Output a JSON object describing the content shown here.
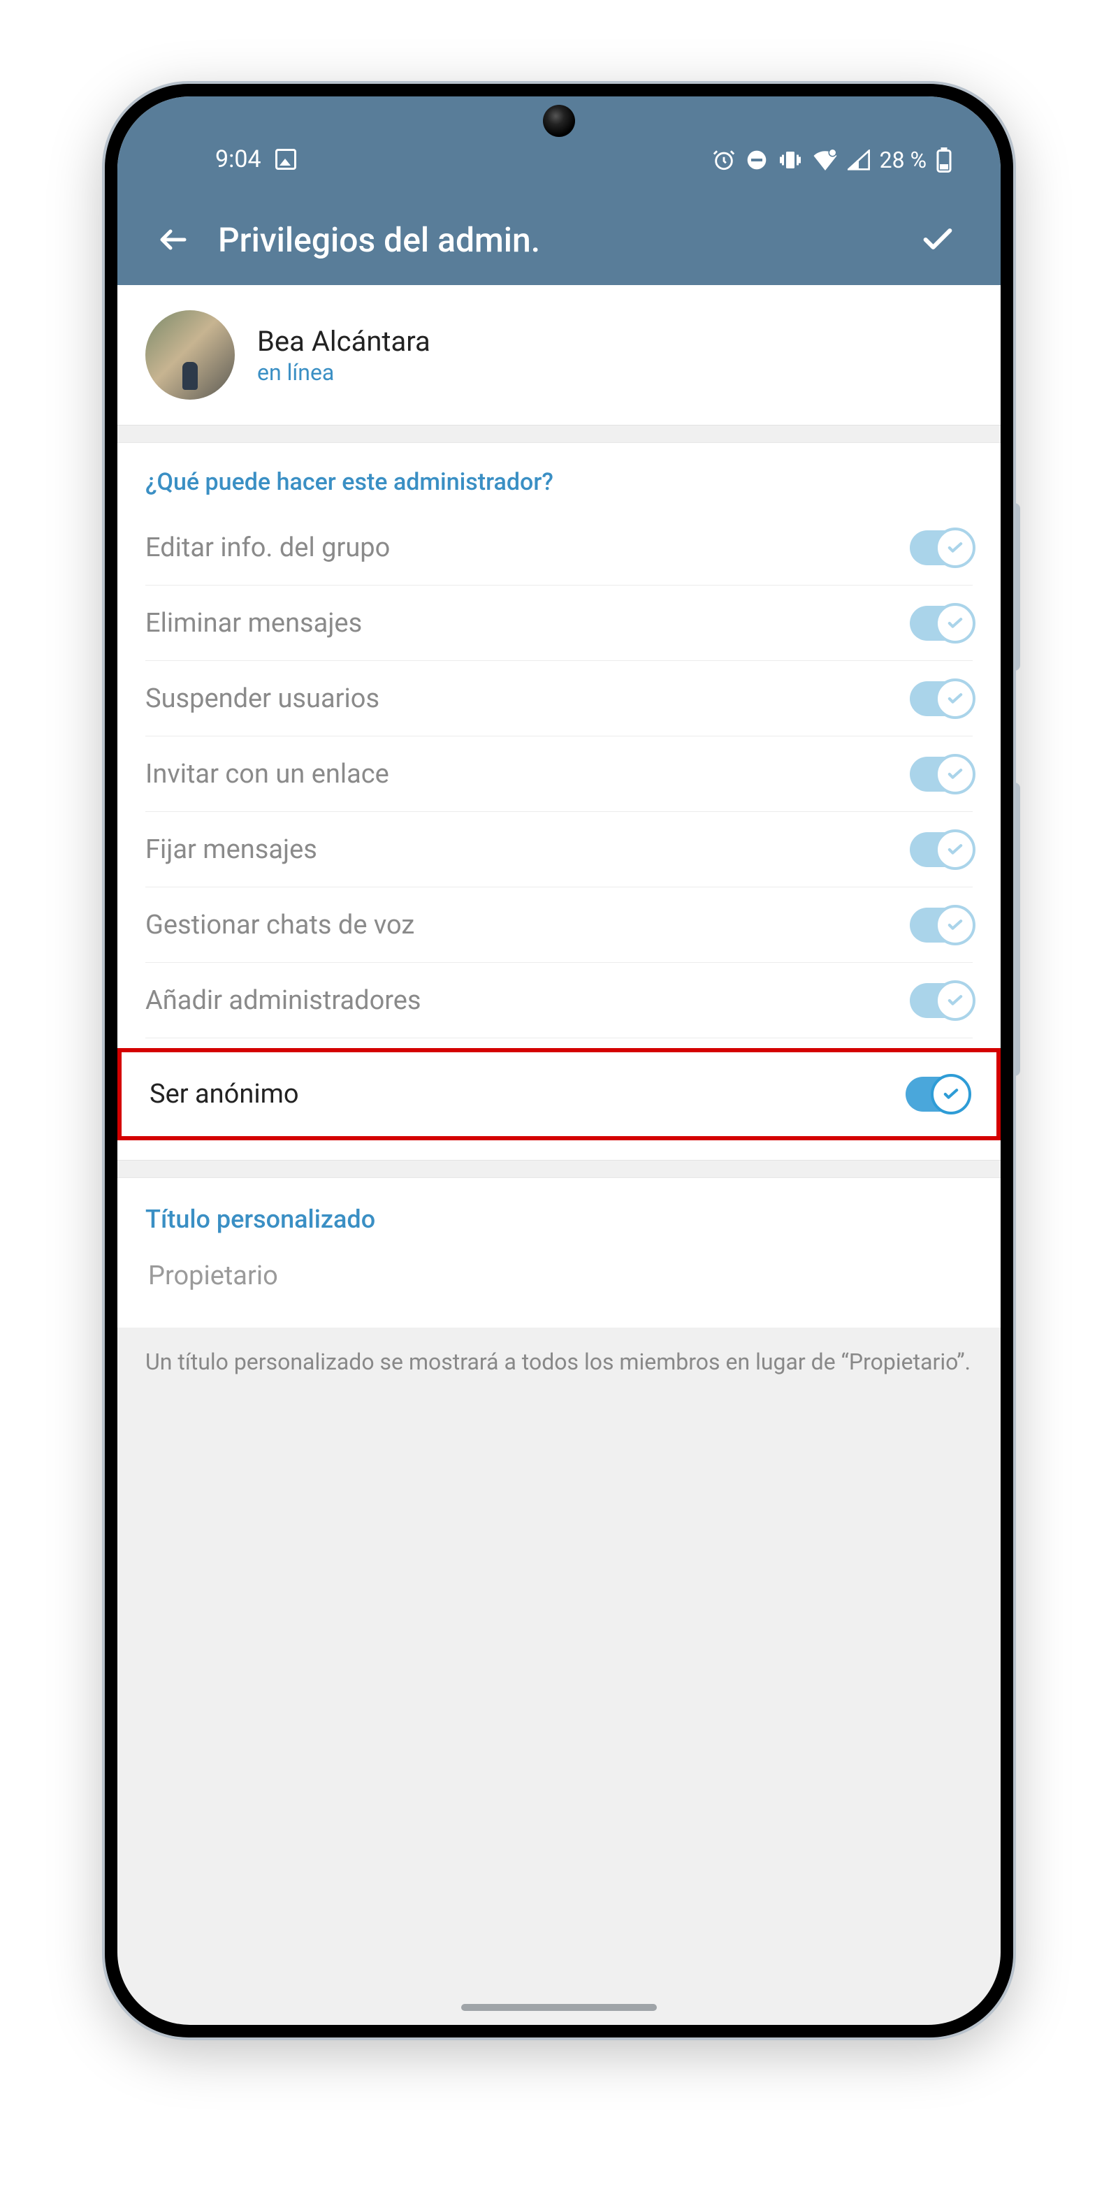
{
  "status": {
    "time": "9:04",
    "battery_text": "28 %"
  },
  "appbar": {
    "title": "Privilegios del admin."
  },
  "profile": {
    "name": "Bea Alcántara",
    "status": "en línea"
  },
  "section": {
    "header": "¿Qué puede hacer este administrador?",
    "permissions": [
      {
        "label": "Editar info. del grupo"
      },
      {
        "label": "Eliminar mensajes"
      },
      {
        "label": "Suspender usuarios"
      },
      {
        "label": "Invitar con un enlace"
      },
      {
        "label": "Fijar mensajes"
      },
      {
        "label": "Gestionar chats de voz"
      },
      {
        "label": "Añadir administradores"
      }
    ],
    "highlighted": {
      "label": "Ser anónimo"
    }
  },
  "custom_title": {
    "header": "Título personalizado",
    "placeholder": "Propietario",
    "note": "Un título personalizado se mostrará a todos los miembros en lugar de “Propietario”."
  }
}
